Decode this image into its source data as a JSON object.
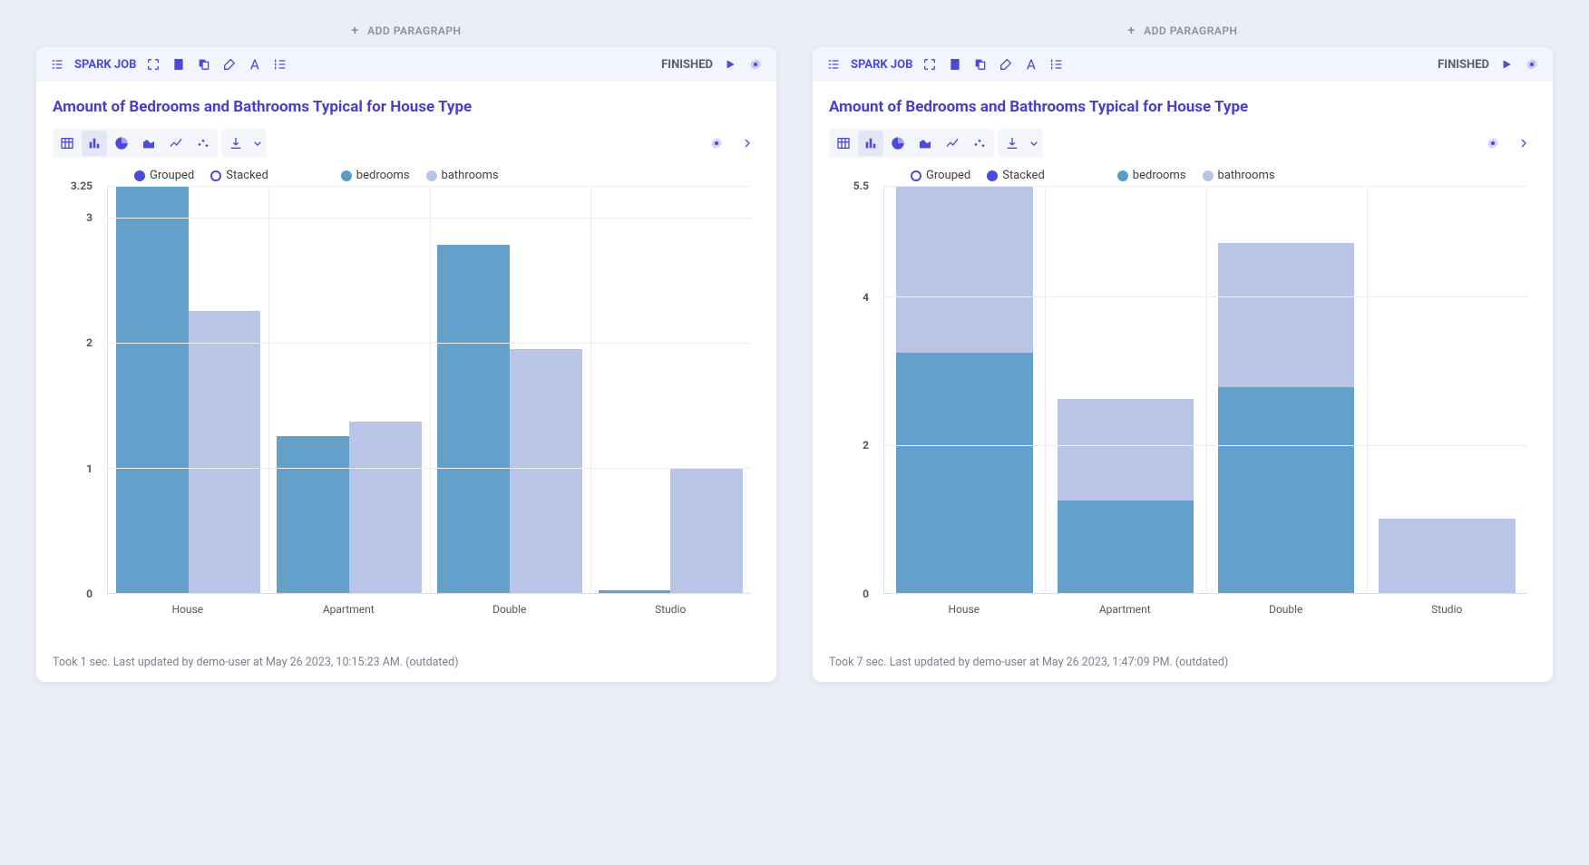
{
  "add_paragraph_label": "ADD PARAGRAPH",
  "spark_job_label": "SPARK JOB",
  "status_label": "FINISHED",
  "panels": [
    {
      "title": "Amount of Bedrooms and Bathrooms Typical for House Type",
      "legend_mode": {
        "grouped": "Grouped",
        "stacked": "Stacked",
        "selected": "grouped"
      },
      "legend_series": [
        {
          "name": "bedrooms"
        },
        {
          "name": "bathrooms"
        }
      ],
      "footer": "Took 1 sec. Last updated by demo-user at May 26 2023, 10:15:23 AM. (outdated)"
    },
    {
      "title": "Amount of Bedrooms and Bathrooms Typical for House Type",
      "legend_mode": {
        "grouped": "Grouped",
        "stacked": "Stacked",
        "selected": "stacked"
      },
      "legend_series": [
        {
          "name": "bedrooms"
        },
        {
          "name": "bathrooms"
        }
      ],
      "footer": "Took 7 sec. Last updated by demo-user at May 26 2023, 1:47:09 PM. (outdated)"
    }
  ],
  "chart_data": [
    {
      "type": "bar",
      "mode": "grouped",
      "title": "Amount of Bedrooms and Bathrooms Typical for House Type",
      "categories": [
        "House",
        "Apartment",
        "Double",
        "Studio"
      ],
      "series": [
        {
          "name": "bedrooms",
          "color": "#63a1cb",
          "values": [
            3.25,
            1.25,
            2.78,
            0.02
          ]
        },
        {
          "name": "bathrooms",
          "color": "#b8c5e6",
          "values": [
            2.25,
            1.37,
            1.95,
            1.0
          ]
        }
      ],
      "ylim": [
        0,
        3.25
      ],
      "yticks": [
        0,
        1,
        2,
        3,
        3.25
      ],
      "xlabel": "",
      "ylabel": ""
    },
    {
      "type": "bar",
      "mode": "stacked",
      "title": "Amount of Bedrooms and Bathrooms Typical for House Type",
      "categories": [
        "House",
        "Apartment",
        "Double",
        "Studio"
      ],
      "series": [
        {
          "name": "bedrooms",
          "color": "#63a1cb",
          "values": [
            3.25,
            1.25,
            2.78,
            0.0
          ]
        },
        {
          "name": "bathrooms",
          "color": "#b8c5e6",
          "values": [
            2.25,
            1.37,
            1.95,
            1.0
          ]
        }
      ],
      "ylim": [
        0,
        5.5
      ],
      "yticks": [
        0,
        2,
        4,
        5.5
      ],
      "xlabel": "",
      "ylabel": ""
    }
  ]
}
